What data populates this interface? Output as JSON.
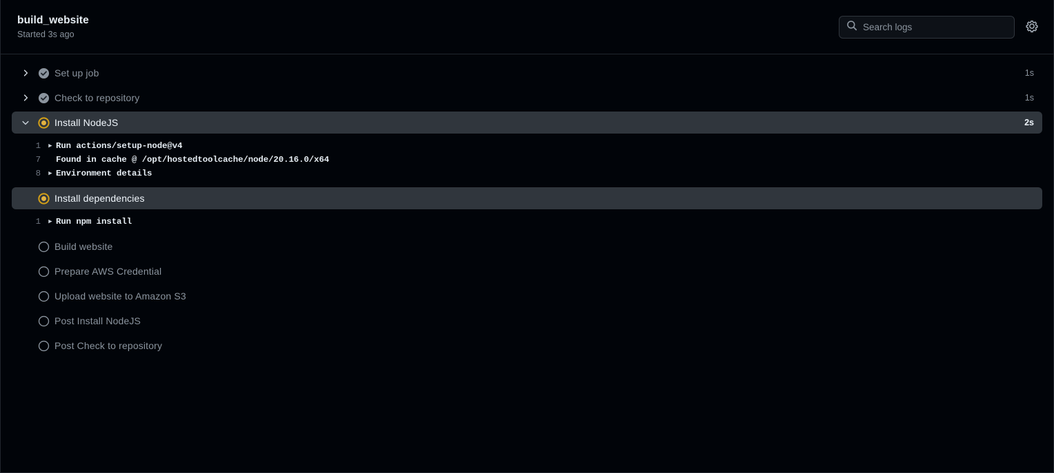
{
  "header": {
    "title": "build_website",
    "subtitle": "Started 3s ago",
    "search": {
      "placeholder": "Search logs",
      "value": "",
      "icon": "search-icon"
    },
    "settings_icon": "gear-icon"
  },
  "colors": {
    "background": "#010409",
    "active_row": "#30363d",
    "in_progress": "#d4a017",
    "success": "#8b949e",
    "text_primary": "#f0f6fc",
    "text_muted": "#8b949e",
    "border": "#21262d"
  },
  "steps": [
    {
      "name": "Set up job",
      "status": "success",
      "status_icon": "check-circle-icon",
      "duration": "1s",
      "expanded": false,
      "has_chevron": true,
      "chevron_icon": "chevron-right-icon",
      "logs": []
    },
    {
      "name": "Check to repository",
      "status": "success",
      "status_icon": "check-circle-icon",
      "duration": "1s",
      "expanded": false,
      "has_chevron": true,
      "chevron_icon": "chevron-right-icon",
      "logs": []
    },
    {
      "name": "Install NodeJS",
      "status": "in_progress",
      "status_icon": "in-progress-circle-icon",
      "duration": "2s",
      "expanded": true,
      "has_chevron": true,
      "chevron_icon": "chevron-down-icon",
      "logs": [
        {
          "num": "1",
          "triangle": true,
          "text": "Run actions/setup-node@v4",
          "bold": true
        },
        {
          "num": "7",
          "triangle": false,
          "text": "Found in cache @ /opt/hostedtoolcache/node/20.16.0/x64",
          "bold": true
        },
        {
          "num": "8",
          "triangle": true,
          "text": "Environment details",
          "bold": true
        }
      ]
    },
    {
      "name": "Install dependencies",
      "status": "in_progress",
      "status_icon": "in-progress-circle-icon",
      "duration": "",
      "expanded": true,
      "has_chevron": false,
      "chevron_icon": "",
      "logs": [
        {
          "num": "1",
          "triangle": true,
          "text": "Run npm install",
          "bold": true
        }
      ]
    },
    {
      "name": "Build website",
      "status": "pending",
      "status_icon": "empty-circle-icon",
      "duration": "",
      "expanded": false,
      "has_chevron": false,
      "chevron_icon": "",
      "logs": []
    },
    {
      "name": "Prepare AWS Credential",
      "status": "pending",
      "status_icon": "empty-circle-icon",
      "duration": "",
      "expanded": false,
      "has_chevron": false,
      "chevron_icon": "",
      "logs": []
    },
    {
      "name": "Upload website to Amazon S3",
      "status": "pending",
      "status_icon": "empty-circle-icon",
      "duration": "",
      "expanded": false,
      "has_chevron": false,
      "chevron_icon": "",
      "logs": []
    },
    {
      "name": "Post Install NodeJS",
      "status": "pending",
      "status_icon": "empty-circle-icon",
      "duration": "",
      "expanded": false,
      "has_chevron": false,
      "chevron_icon": "",
      "logs": []
    },
    {
      "name": "Post Check to repository",
      "status": "pending",
      "status_icon": "empty-circle-icon",
      "duration": "",
      "expanded": false,
      "has_chevron": false,
      "chevron_icon": "",
      "logs": []
    }
  ]
}
